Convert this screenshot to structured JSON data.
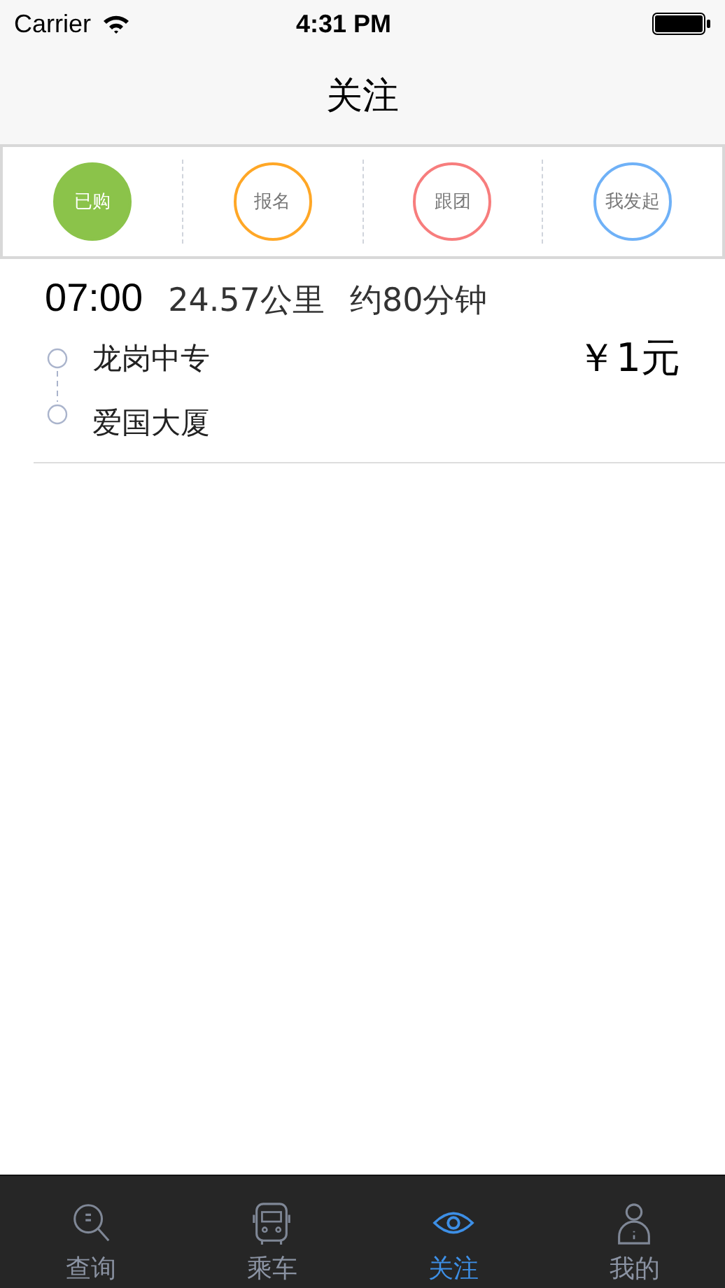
{
  "status_bar": {
    "carrier": "Carrier",
    "time": "4:31 PM"
  },
  "nav": {
    "title": "关注"
  },
  "filters": [
    {
      "label": "已购",
      "color": "#8bc34a",
      "selected": true
    },
    {
      "label": "报名",
      "color": "#ffa726",
      "selected": false
    },
    {
      "label": "跟团",
      "color": "#f77d7d",
      "selected": false
    },
    {
      "label": "我发起",
      "color": "#6fb1f7",
      "selected": false
    }
  ],
  "trips": [
    {
      "time": "07:00",
      "distance": "24.57公里",
      "duration": "约80分钟",
      "from": "龙岗中专",
      "to": "爱国大厦",
      "price": "￥1元"
    }
  ],
  "tab_bar": [
    {
      "label": "查询",
      "kind": "search",
      "selected": false
    },
    {
      "label": "乘车",
      "kind": "bus",
      "selected": false
    },
    {
      "label": "关注",
      "kind": "eye",
      "selected": true
    },
    {
      "label": "我的",
      "kind": "person",
      "selected": false
    }
  ]
}
